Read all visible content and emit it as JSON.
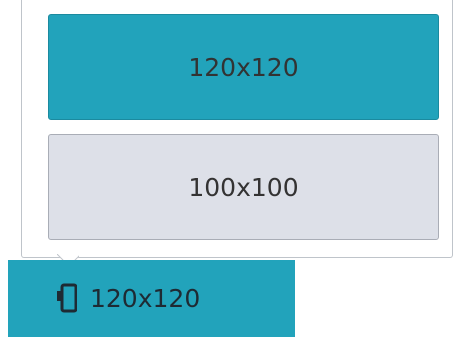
{
  "popup": {
    "options": [
      {
        "label": "120x120",
        "selected": true
      },
      {
        "label": "100x100",
        "selected": false
      }
    ]
  },
  "footer": {
    "icon": "device-frame-icon",
    "label": "120x120"
  },
  "colors": {
    "accent": "#22a3bb",
    "unselected": "#dde0e8",
    "text": "#333333"
  }
}
